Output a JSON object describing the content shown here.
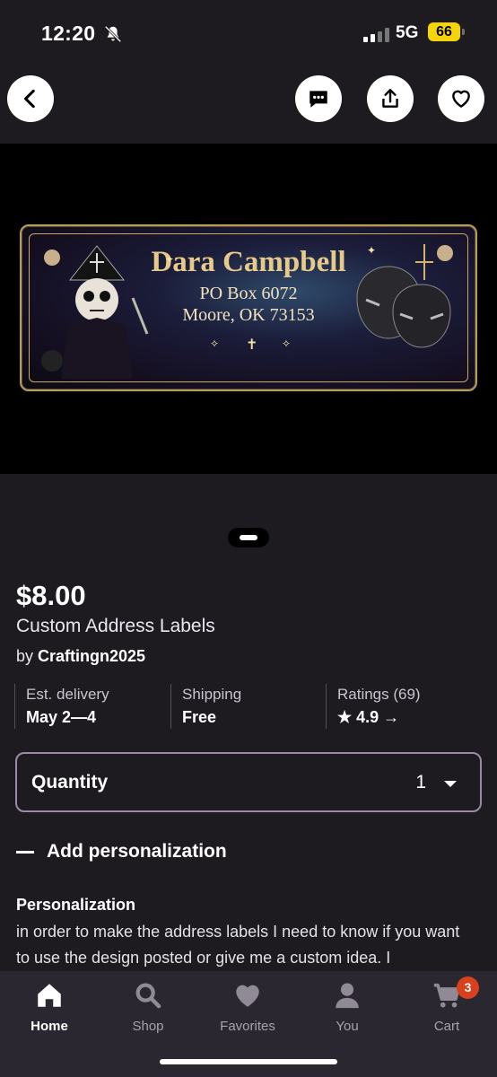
{
  "status": {
    "time": "12:20",
    "network": "5G",
    "battery": "66"
  },
  "product_image": {
    "name": "Dara Campbell",
    "address_line1": "PO Box 6072",
    "address_line2": "Moore, OK 73153"
  },
  "product": {
    "price": "$8.00",
    "title": "Custom Address Labels",
    "by_prefix": "by",
    "shop": "Craftingn2025"
  },
  "facts": [
    {
      "key": "Est. delivery",
      "value": "May 2—4"
    },
    {
      "key": "Shipping",
      "value": "Free"
    },
    {
      "key": "Ratings (69)",
      "value": "★ 4.9 →"
    }
  ],
  "quantity": {
    "label": "Quantity",
    "value": "1"
  },
  "personalization": {
    "toggle_label": "Add personalization",
    "heading": "Personalization",
    "text": "in order to make the address labels I need to know if you want to use the design posted or give me a custom idea. I"
  },
  "tabs": [
    {
      "label": "Home",
      "icon": "home-icon"
    },
    {
      "label": "Shop",
      "icon": "search-icon"
    },
    {
      "label": "Favorites",
      "icon": "heart-icon"
    },
    {
      "label": "You",
      "icon": "person-icon"
    },
    {
      "label": "Cart",
      "icon": "cart-icon"
    }
  ],
  "cart_badge": "3",
  "colors": {
    "background": "#1d1b20",
    "tabbar": "#2a2730",
    "badge": "#d8401e",
    "quantity_border": "#9b8aa6"
  }
}
